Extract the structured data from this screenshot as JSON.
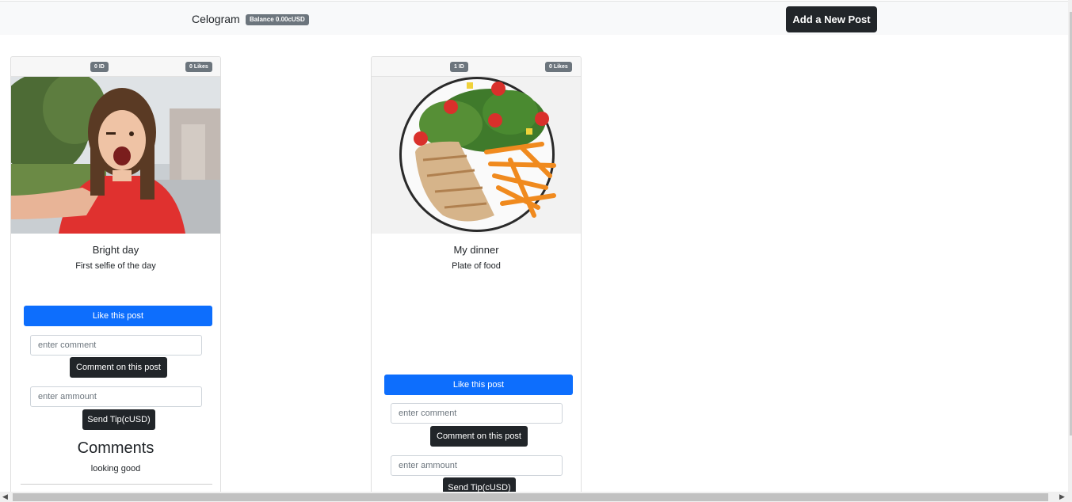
{
  "navbar": {
    "brand": "Celogram",
    "balance": "Balance 0.00cUSD",
    "add_post_label": "Add a New Post"
  },
  "posts": [
    {
      "id_badge": "0 ID",
      "likes_badge": "0 Likes",
      "image_desc": "selfie",
      "title": "Bright day",
      "description": "First selfie of the day",
      "like_label": "Like this post",
      "comment_placeholder": "enter comment",
      "comment_button": "Comment on this post",
      "amount_placeholder": "enter ammount",
      "tip_button": "Send Tip(cUSD)",
      "comments_heading": "Comments",
      "comments": [
        "looking good"
      ]
    },
    {
      "id_badge": "1 ID",
      "likes_badge": "0 Likes",
      "image_desc": "plate-of-food",
      "title": "My dinner",
      "description": "Plate of food",
      "like_label": "Like this post",
      "comment_placeholder": "enter comment",
      "comment_button": "Comment on this post",
      "amount_placeholder": "enter ammount",
      "tip_button": "Send Tip(cUSD)"
    }
  ],
  "colors": {
    "primary": "#0d6efd",
    "dark": "#212529",
    "badge": "#6c757d",
    "navbar_bg": "#f8f9fa"
  }
}
